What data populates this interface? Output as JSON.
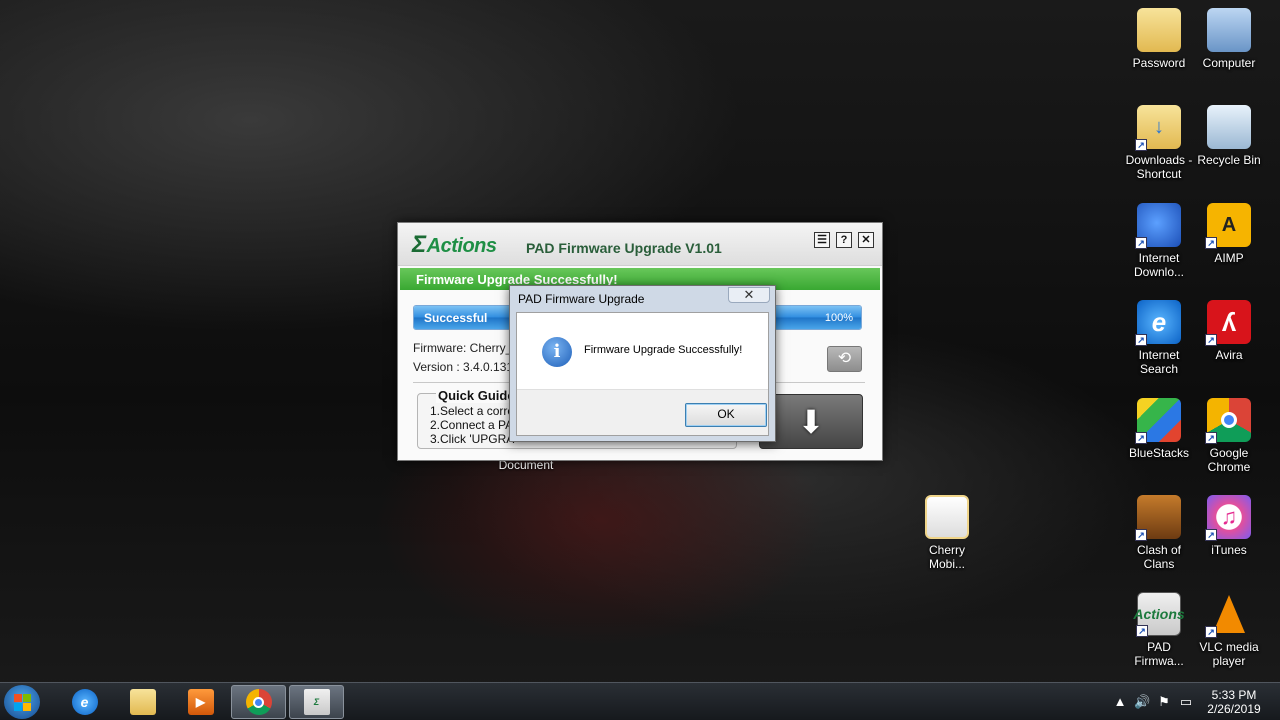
{
  "desktop": {
    "icons": [
      {
        "label": "Password",
        "glyph": "",
        "kind": "folder-icon"
      },
      {
        "label": "Computer",
        "glyph": "",
        "kind": "computer-icon"
      },
      {
        "label": "Downloads - Shortcut",
        "glyph": "↓",
        "kind": "folder-shortcut-icon"
      },
      {
        "label": "Recycle Bin",
        "glyph": "",
        "kind": "recycle-bin-icon"
      },
      {
        "label": "Internet Downlo...",
        "glyph": "",
        "kind": "idm-icon"
      },
      {
        "label": "AIMP",
        "glyph": "A",
        "kind": "aimp-icon"
      },
      {
        "label": "Internet Search",
        "glyph": "e",
        "kind": "ie-icon"
      },
      {
        "label": "Avira",
        "glyph": "ʎ",
        "kind": "avira-icon"
      },
      {
        "label": "BlueStacks",
        "glyph": "",
        "kind": "bluestacks-icon"
      },
      {
        "label": "Google Chrome",
        "glyph": "",
        "kind": "chrome-icon"
      },
      {
        "label": "Clash of Clans",
        "glyph": "",
        "kind": "clash-of-clans-icon"
      },
      {
        "label": "iTunes",
        "glyph": "♫",
        "kind": "itunes-icon"
      },
      {
        "label": "PAD Firmwa...",
        "glyph": "Actions",
        "kind": "pad-firmware-icon"
      },
      {
        "label": "VLC media player",
        "glyph": "",
        "kind": "vlc-icon"
      },
      {
        "label": "Cherry Mobi...",
        "glyph": "",
        "kind": "folder-icon"
      }
    ],
    "document_label": "Document"
  },
  "app": {
    "logo": "Actions",
    "title": "PAD Firmware Upgrade V1.01",
    "buttons": {
      "menu": "☰",
      "help": "?",
      "close": "✕"
    },
    "status_banner": "Firmware Upgrade Successfully!",
    "progress": {
      "label": "Successful",
      "percent_text": "100%",
      "value": 1.0
    },
    "firmware_text": "Firmware: Cherry_",
    "version_text": "Version : 3.4.0.131",
    "guide": {
      "title": "Quick Guide",
      "lines": [
        "1.Select a corre",
        "2.Connect a PAD",
        "3.Click 'UPGRA"
      ]
    }
  },
  "dialog": {
    "title": "PAD Firmware Upgrade",
    "close": "✕",
    "message": "Firmware Upgrade Successfully!",
    "ok": "OK"
  },
  "taskbar": {
    "items": [
      "ie-icon",
      "file-explorer-icon",
      "media-player-icon",
      "chrome-icon",
      "pad-firmware-icon"
    ],
    "tray": [
      "▲",
      "🔊",
      "⚑",
      "▭"
    ],
    "time": "5:33 PM",
    "date": "2/26/2019"
  },
  "colors": {
    "accent_green": "#39a832",
    "progress_blue": "#2f8de0",
    "dialog_border": "#3c7fb1"
  }
}
